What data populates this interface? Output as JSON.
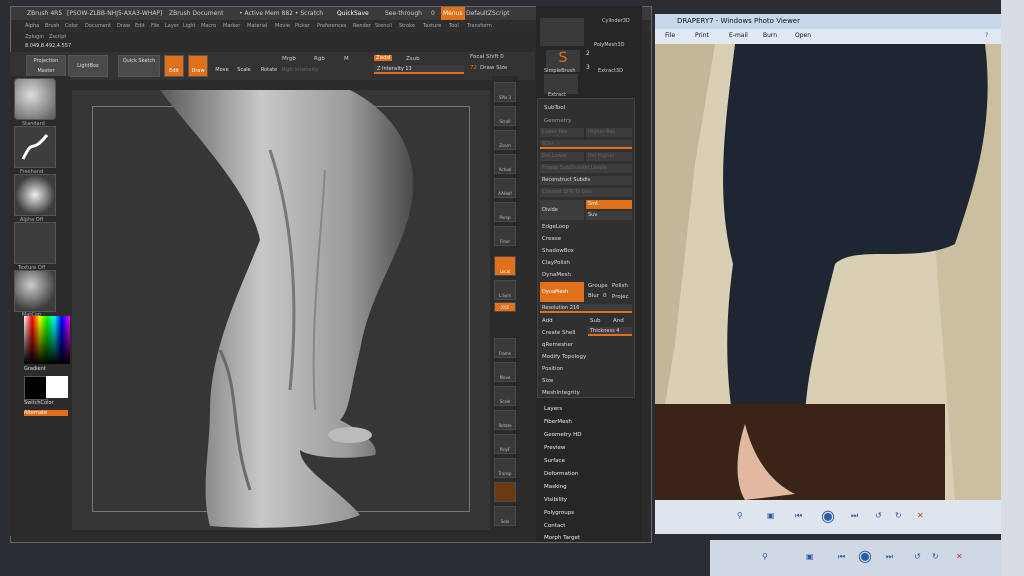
{
  "zbrush": {
    "title_items": [
      "ZBrush 4R5",
      "[PSOW-ZLBB-NHJ5-AXA3-WHAP]",
      "ZBrush Document",
      "• Active Mem 882 • Scratch",
      "QuickSave",
      "See-through",
      "0",
      "Menus",
      "DefaultZScript"
    ],
    "menu_items": [
      "Alpha",
      "Brush",
      "Color",
      "Document",
      "Draw",
      "Edit",
      "File",
      "Layer",
      "Light",
      "Macro",
      "Marker",
      "Material",
      "Movie",
      "Picker",
      "Preferences",
      "Render",
      "Stencil",
      "Stroke",
      "Texture",
      "Tool",
      "Transform"
    ],
    "menu_row2": [
      "Zplugin",
      "Zscript"
    ],
    "coords": "8.049,8.492,4.557",
    "toolbar": {
      "projection_master": "Projection Master",
      "lightbox": "LightBox",
      "quick_sketch": "Quick Sketch",
      "edit": "Edit",
      "draw": "Draw",
      "move": "Move",
      "scale": "Scale",
      "rotate": "Rotate",
      "mrgb": "Mrgb",
      "rgb": "Rgb",
      "m": "M",
      "rgb_intensity": "Rgb Intensity",
      "zadd": "Zadd",
      "zsub": "Zsub",
      "z_intensity": "Z Intensity 13",
      "focal_shift": "Focal Shift 0",
      "draw_size_num": "72",
      "draw_size": "Draw Size"
    },
    "left_shelf": {
      "brush": "Standard",
      "stroke": "Freehand",
      "alpha": "Alpha Off",
      "texture": "Texture Off",
      "material": "MatCap",
      "gradient": "Gradient",
      "switch_color": "SwitchColor",
      "alternate": "Alternate"
    },
    "right_shelf": [
      "SPix 3",
      "Scroll",
      "Zoom",
      "Actual",
      "AAHalf",
      "Persp",
      "Floor",
      "Local",
      "L.Sym",
      "XYZ",
      "Frame",
      "Move",
      "Scale",
      "Rotate",
      "PolyF",
      "Transp",
      "Solo"
    ],
    "tool_tray": {
      "cylinder": "Cylinder3D",
      "polymesh": "PolyMesh3D",
      "simplebrush": "SimpleBrush",
      "extract": "Extract3D",
      "extract2": "Extract",
      "num1": "2",
      "num2": "3"
    },
    "subtool_panel": {
      "subtool": "SubTool",
      "geometry": "Geometry",
      "lower_res": "Lower Res",
      "higher_res": "Higher Res",
      "sdiv": "SDiv",
      "del_lower": "Del Lower",
      "del_higher": "Del Higher",
      "freeze": "Freeze SubDivision Levels",
      "reconstruct": "Reconstruct Subdiv",
      "convert": "Convert BPR To Geo",
      "divide": "Divide",
      "smt": "Smt",
      "suv": "Suv",
      "edgeloop": "EdgeLoop",
      "crease": "Crease",
      "shadowbox": "ShadowBox",
      "claypolish": "ClayPolish",
      "dynamesh_header": "DynaMesh",
      "dynamesh": "DynaMesh",
      "groups": "Groups",
      "polish": "Polish",
      "blur": "Blur",
      "blur_val": "0",
      "project": "Projec",
      "resolution": "Resolution 216",
      "add": "Add",
      "sub": "Sub",
      "and": "And",
      "create_shell": "Create Shell",
      "thickness": "Thickness 4",
      "qremesher": "qRemesher",
      "modify_topology": "Modify Topology",
      "position": "Position",
      "size": "Size",
      "meshintegrity": "MeshIntegrity"
    },
    "tool_menu_items": [
      "Layers",
      "FiberMesh",
      "Geometry HD",
      "Preview",
      "Surface",
      "Deformation",
      "Masking",
      "Visibility",
      "Polygroups",
      "Contact",
      "Morph Target"
    ]
  },
  "photo_viewer": {
    "title": "DRAPERY7 - Windows Photo Viewer",
    "menu": [
      "File",
      "Print",
      "E-mail",
      "Burn",
      "Open"
    ]
  },
  "colors": {
    "accent": "#e0711a",
    "zbrush_bg": "#2b2b2b",
    "canvas_bg": "#363636",
    "viewer_blue": "#2a5ea8"
  }
}
